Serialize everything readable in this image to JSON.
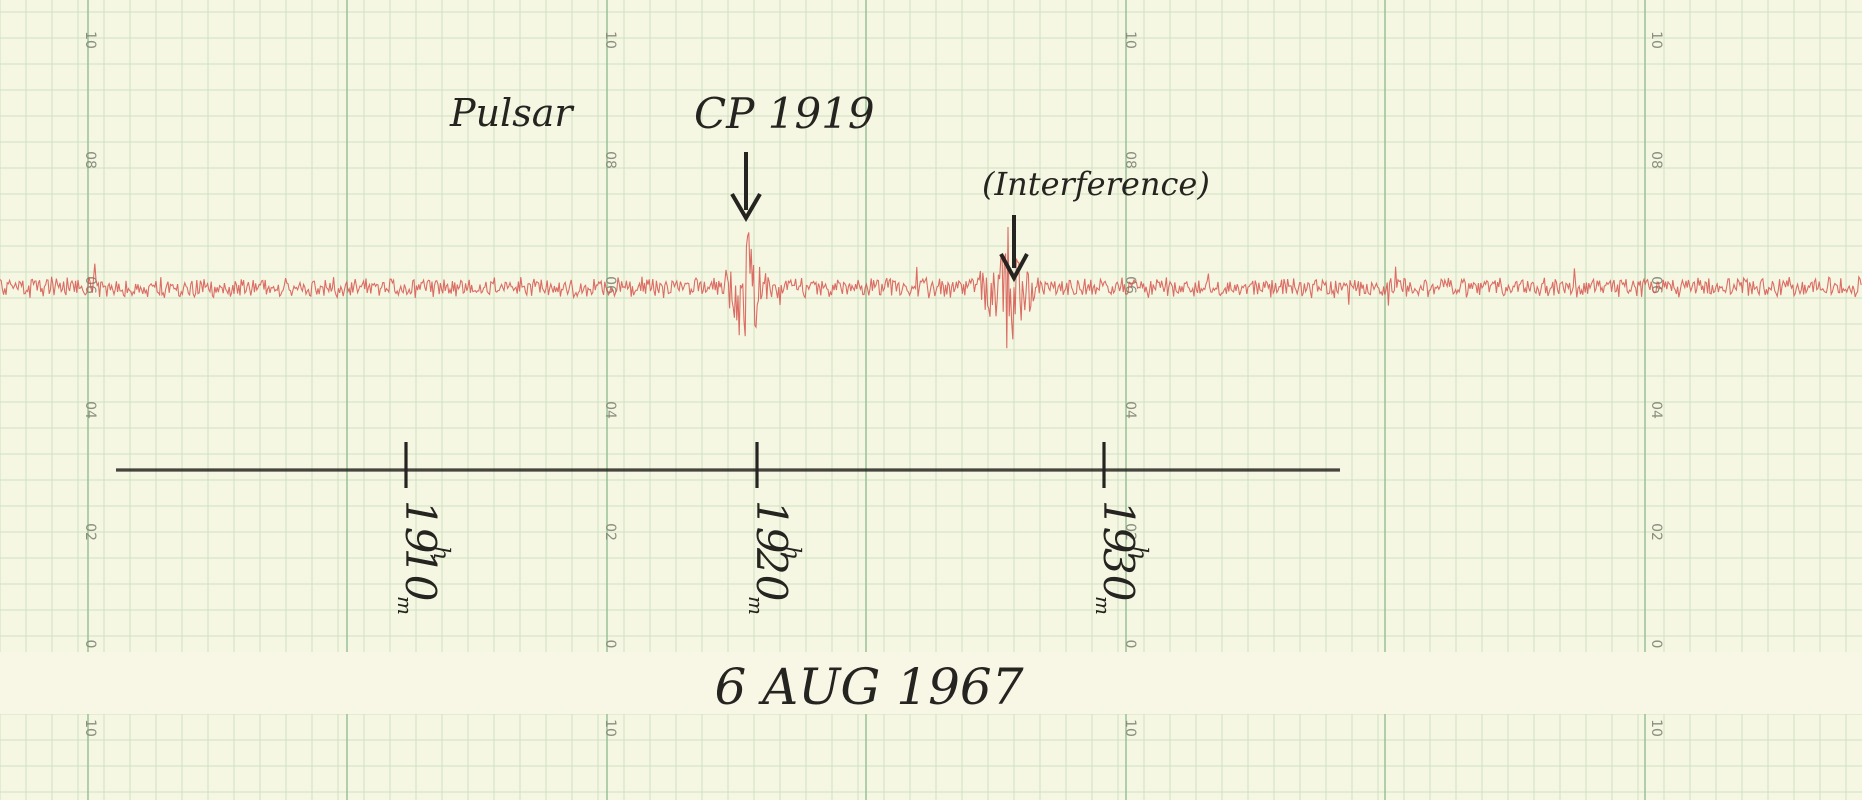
{
  "chart_data": {
    "type": "line",
    "series": [
      {
        "color": "#d6554d",
        "description": "noisy receiver trace with a pulse burst near 19h20m and an interference burst near 19h26m",
        "baseline": 0.5,
        "bursts": [
          {
            "time": "19h20m",
            "peak": 0.62,
            "low": 0.44
          },
          {
            "time": "19h26.5m",
            "peak": 0.6,
            "low": 0.38
          }
        ]
      }
    ],
    "y_ticks": [
      "10",
      "08",
      "06",
      "04",
      "02",
      "0"
    ],
    "lower_strip_tick": "10",
    "grid": true,
    "colors": {
      "paper": "#f6f7e3",
      "grid_fine": "#cfe0c0",
      "grid_major": "#9fc39a",
      "trace": "#d6554d",
      "ink": "#262420",
      "date_band": "#f8f7e5"
    },
    "time_marks": [
      {
        "hours": "19",
        "hours_suffix": "h",
        "minutes": "10",
        "minutes_suffix": "m"
      },
      {
        "hours": "19",
        "hours_suffix": "h",
        "minutes": "20",
        "minutes_suffix": "m"
      },
      {
        "hours": "19",
        "hours_suffix": "h",
        "minutes": "30",
        "minutes_suffix": "m"
      }
    ],
    "annotations": {
      "pulsar_word": "Pulsar",
      "pulsar_name": "CP 1919",
      "interference": "(Interference)",
      "date": "6 AUG 1967"
    }
  }
}
